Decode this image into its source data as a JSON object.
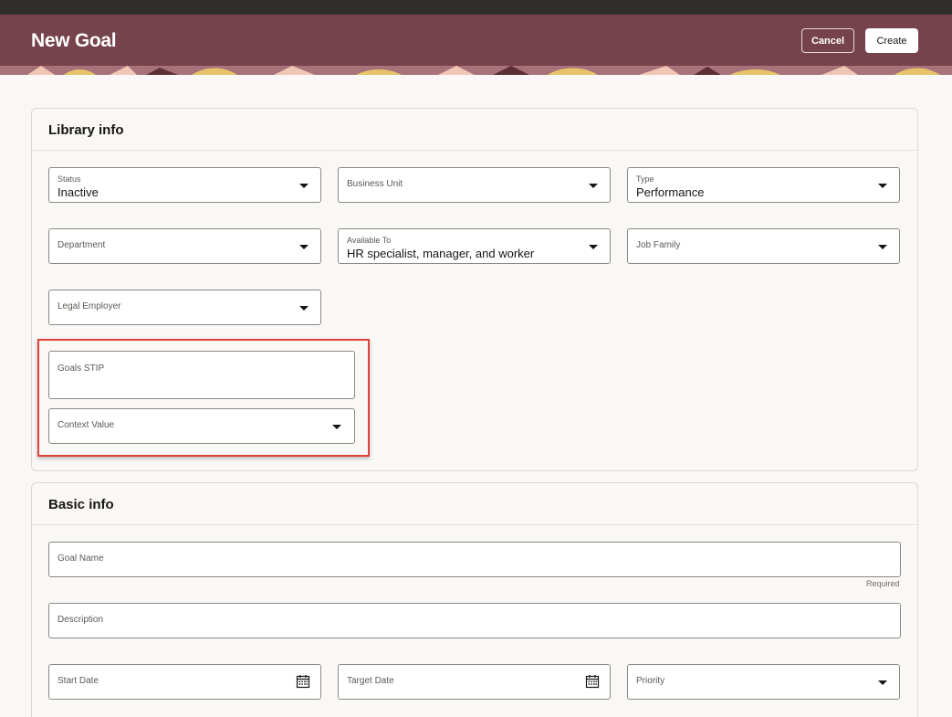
{
  "header": {
    "title": "New Goal",
    "cancel_label": "Cancel",
    "create_label": "Create"
  },
  "library_info": {
    "title": "Library info",
    "status": {
      "label": "Status",
      "value": "Inactive"
    },
    "business_unit": {
      "label": "Business Unit"
    },
    "type": {
      "label": "Type",
      "value": "Performance"
    },
    "department": {
      "label": "Department"
    },
    "available_to": {
      "label": "Available To",
      "value": "HR specialist, manager, and worker"
    },
    "job_family": {
      "label": "Job Family"
    },
    "legal_employer": {
      "label": "Legal Employer"
    },
    "goals_stip": {
      "label": "Goals STIP"
    },
    "context_value": {
      "label": "Context Value"
    }
  },
  "basic_info": {
    "title": "Basic info",
    "goal_name": {
      "label": "Goal Name",
      "hint": "Required"
    },
    "description": {
      "label": "Description"
    },
    "start_date": {
      "label": "Start Date"
    },
    "target_date": {
      "label": "Target Date"
    },
    "priority": {
      "label": "Priority"
    }
  },
  "colors": {
    "header": "#76424c",
    "topbar": "#312d2a",
    "highlight": "#e0413b"
  },
  "icons": {
    "dropdown": "chevron-down-icon",
    "date": "calendar-icon"
  }
}
